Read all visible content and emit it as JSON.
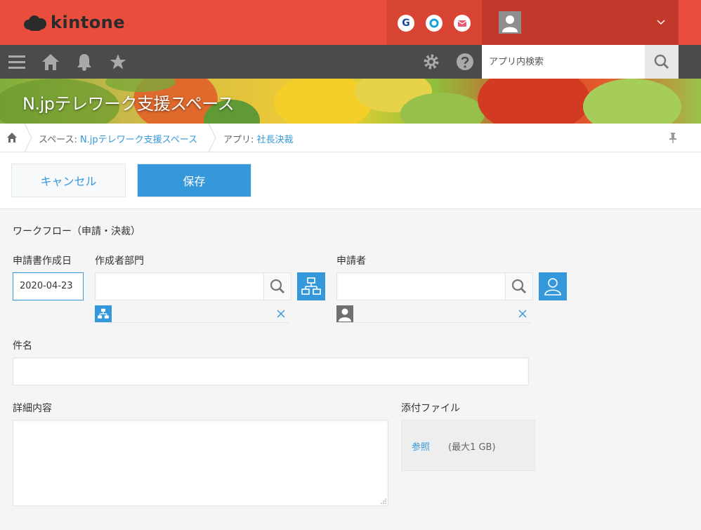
{
  "header": {
    "logo_text": "kintone",
    "apps": [
      {
        "name": "google-app-icon",
        "glyph": "G",
        "color": "#1a4aa0"
      },
      {
        "name": "garoon-app-icon",
        "glyph": "",
        "color": "#1aa0d6"
      },
      {
        "name": "mail-app-icon",
        "glyph": "",
        "color": "#e85a7a"
      }
    ],
    "brand_color": "#e84d3d"
  },
  "nav": {
    "search_placeholder": "アプリ内検索"
  },
  "banner": {
    "title": "N.jpテレワーク支援スペース"
  },
  "breadcrumb": {
    "space_prefix": "スペース: ",
    "space_name": "N.jpテレワーク支援スペース",
    "app_prefix": "アプリ: ",
    "app_name": "社長決裁"
  },
  "toolbar": {
    "cancel_label": "キャンセル",
    "save_label": "保存"
  },
  "form": {
    "section_title": "ワークフロー（申請・決裁）",
    "date_label": "申請書作成日",
    "date_value": "2020-04-23",
    "dept_label": "作成者部門",
    "applicant_label": "申請者",
    "subject_label": "件名",
    "details_label": "詳細内容",
    "attachment_label": "添付ファイル",
    "browse_label": "参照",
    "max_size_note": "(最大1 GB)"
  },
  "colors": {
    "accent": "#3498db",
    "nav_bg": "#4b4b4b"
  }
}
